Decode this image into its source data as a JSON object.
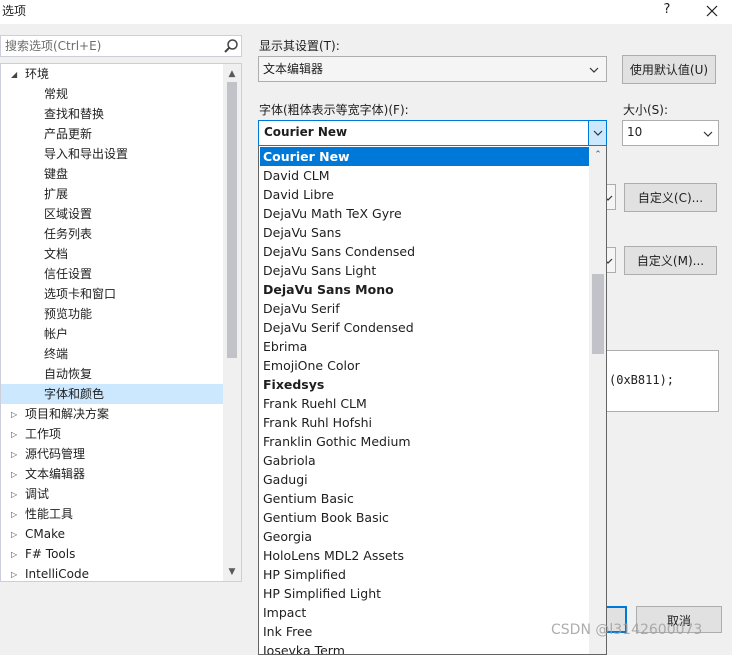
{
  "window": {
    "title": "选项",
    "help": "?",
    "close": "✕"
  },
  "search": {
    "placeholder": "搜索选项(Ctrl+E)"
  },
  "tree": {
    "environment_label": "环境",
    "env_children": [
      "常规",
      "查找和替换",
      "产品更新",
      "导入和导出设置",
      "键盘",
      "扩展",
      "区域设置",
      "任务列表",
      "文档",
      "信任设置",
      "选项卡和窗口",
      "预览功能",
      "帐户",
      "终端",
      "自动恢复",
      "字体和颜色"
    ],
    "selected": "字体和颜色",
    "collapsed": [
      "项目和解决方案",
      "工作项",
      "源代码管理",
      "文本编辑器",
      "调试",
      "性能工具",
      "CMake",
      "F# Tools",
      "IntelliCode"
    ]
  },
  "settings": {
    "show_settings_label": "显示其设置(T):",
    "show_settings_value": "文本编辑器",
    "use_defaults_button": "使用默认值(U)",
    "font_label": "字体(粗体表示等宽字体)(F):",
    "font_value": "Courier New",
    "size_label": "大小(S):",
    "size_value": "10",
    "custom_c_button": "自定义(C)...",
    "custom_m_button": "自定义(M)...",
    "sample_text": "(0xB811);",
    "cancel_button": "取消"
  },
  "font_list": [
    {
      "name": "Courier New",
      "mono": true,
      "selected": true
    },
    {
      "name": "David CLM",
      "mono": false
    },
    {
      "name": "David Libre",
      "mono": false
    },
    {
      "name": "DejaVu Math TeX Gyre",
      "mono": false
    },
    {
      "name": "DejaVu Sans",
      "mono": false
    },
    {
      "name": "DejaVu Sans Condensed",
      "mono": false
    },
    {
      "name": "DejaVu Sans Light",
      "mono": false
    },
    {
      "name": "DejaVu Sans Mono",
      "mono": true
    },
    {
      "name": "DejaVu Serif",
      "mono": false
    },
    {
      "name": "DejaVu Serif Condensed",
      "mono": false
    },
    {
      "name": "Ebrima",
      "mono": false
    },
    {
      "name": "EmojiOne Color",
      "mono": false
    },
    {
      "name": "Fixedsys",
      "mono": true
    },
    {
      "name": "Frank Ruehl CLM",
      "mono": false
    },
    {
      "name": "Frank Ruhl Hofshi",
      "mono": false
    },
    {
      "name": "Franklin Gothic Medium",
      "mono": false
    },
    {
      "name": "Gabriola",
      "mono": false
    },
    {
      "name": "Gadugi",
      "mono": false
    },
    {
      "name": "Gentium Basic",
      "mono": false
    },
    {
      "name": "Gentium Book Basic",
      "mono": false
    },
    {
      "name": "Georgia",
      "mono": false
    },
    {
      "name": "HoloLens MDL2 Assets",
      "mono": false
    },
    {
      "name": "HP Simplified",
      "mono": false
    },
    {
      "name": "HP Simplified Light",
      "mono": false
    },
    {
      "name": "Impact",
      "mono": false
    },
    {
      "name": "Ink Free",
      "mono": false
    },
    {
      "name": "Iosevka Term",
      "mono": false
    }
  ],
  "watermark": "CSDN @l3142600073",
  "colors": {
    "accent": "#0078d7",
    "selection": "#cce8ff"
  }
}
